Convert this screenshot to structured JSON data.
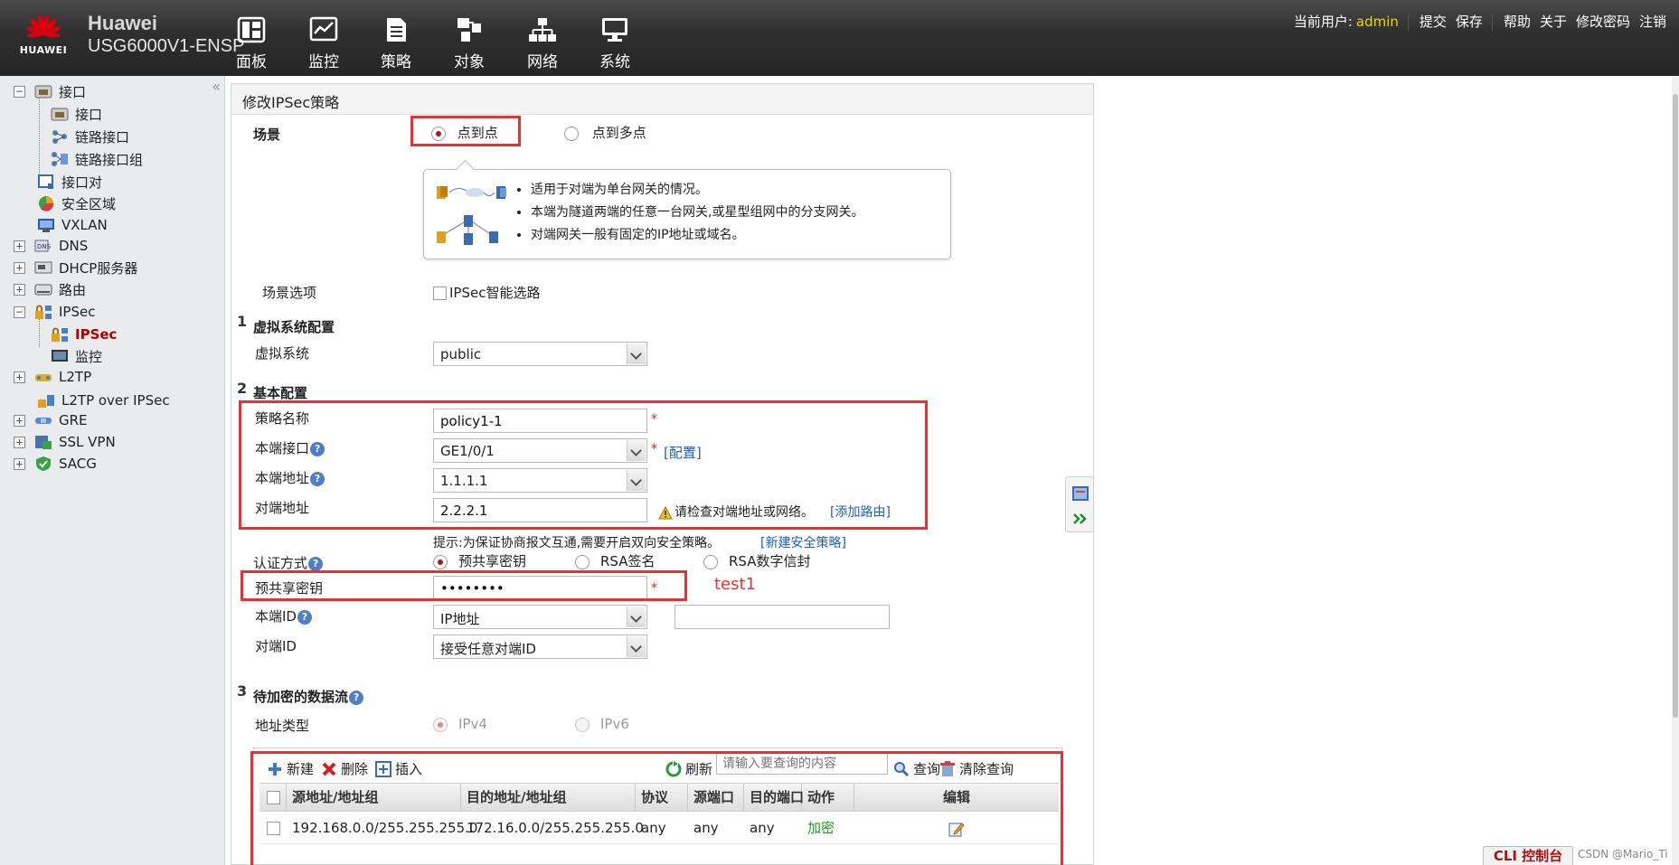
{
  "header": {
    "brand": "Huawei",
    "logo_text": "HUAWEI",
    "model": "USG6000V1-ENSP",
    "nav": [
      {
        "label": "面板",
        "icon": "dashboard-icon"
      },
      {
        "label": "监控",
        "icon": "monitor-icon"
      },
      {
        "label": "策略",
        "icon": "policy-icon"
      },
      {
        "label": "对象",
        "icon": "object-icon"
      },
      {
        "label": "网络",
        "icon": "network-icon"
      },
      {
        "label": "系统",
        "icon": "system-icon"
      }
    ],
    "user_label": "当前用户:",
    "username": "admin",
    "actions": [
      "提交",
      "保存",
      "帮助",
      "关于",
      "修改密码",
      "注销"
    ]
  },
  "sidebar": {
    "items": [
      {
        "label": "接口",
        "icon": "interface-icon",
        "toggle": "−"
      },
      {
        "label": "接口",
        "icon": "interface-icon"
      },
      {
        "label": "链路接口",
        "icon": "link-interface-icon"
      },
      {
        "label": "链路接口组",
        "icon": "link-group-icon"
      },
      {
        "label": "接口对",
        "icon": "interface-pair-icon"
      },
      {
        "label": "安全区域",
        "icon": "security-zone-icon"
      },
      {
        "label": "VXLAN",
        "icon": "vxlan-icon"
      },
      {
        "label": "DNS",
        "icon": "dns-icon",
        "toggle": "+"
      },
      {
        "label": "DHCP服务器",
        "icon": "dhcp-icon",
        "toggle": "+"
      },
      {
        "label": "路由",
        "icon": "route-icon",
        "toggle": "+"
      },
      {
        "label": "IPSec",
        "icon": "ipsec-icon",
        "toggle": "−"
      },
      {
        "label": "IPSec",
        "icon": "ipsec-icon",
        "active": true
      },
      {
        "label": "监控",
        "icon": "monitor-icon"
      },
      {
        "label": "L2TP",
        "icon": "l2tp-icon",
        "toggle": "+"
      },
      {
        "label": "L2TP over IPSec",
        "icon": "l2tp-ipsec-icon"
      },
      {
        "label": "GRE",
        "icon": "gre-icon",
        "toggle": "+"
      },
      {
        "label": "SSL VPN",
        "icon": "ssl-vpn-icon",
        "toggle": "+"
      },
      {
        "label": "SACG",
        "icon": "sacg-icon",
        "toggle": "+"
      }
    ]
  },
  "form": {
    "title": "修改IPSec策略",
    "scene_label": "场景",
    "scene_options": [
      "点到点",
      "点到多点"
    ],
    "scene_selected": "点到点",
    "tips": [
      "适用于对端为单台网关的情况。",
      "本端为隧道两端的任意一台网关,或星型组网中的分支网关。",
      "对端网关一般有固定的IP地址或域名。"
    ],
    "scene_option_label": "场景选项",
    "smart_route_label": "IPSec智能选路",
    "sec1_num": "1",
    "sec1_title": "虚拟系统配置",
    "vsys_label": "虚拟系统",
    "vsys_value": "public",
    "sec2_num": "2",
    "sec2_title": "基本配置",
    "policy_name_label": "策略名称",
    "policy_name_value": "policy1-1",
    "local_if_label": "本端接口",
    "local_if_value": "GE1/0/1",
    "config_link": "[配置]",
    "local_addr_label": "本端地址",
    "local_addr_value": "1.1.1.1",
    "peer_addr_label": "对端地址",
    "peer_addr_value": "2.2.2.1",
    "peer_warn": "请检查对端地址或网络。",
    "add_route_link": "[添加路由]",
    "hint_text": "提示:为保证协商报文互通,需要开启双向安全策略。",
    "new_policy_link": "[新建安全策略]",
    "auth_label": "认证方式",
    "auth_options": [
      "预共享密钥",
      "RSA签名",
      "RSA数字信封"
    ],
    "psk_label": "预共享密钥",
    "psk_value": "••••••••",
    "psk_annotation": "test1",
    "local_id_label": "本端ID",
    "local_id_value": "IP地址",
    "local_id_extra": "",
    "peer_id_label": "对端ID",
    "peer_id_value": "接受任意对端ID",
    "required_mark": "*",
    "help_mark": "?",
    "sec3_num": "3",
    "sec3_title": "待加密的数据流",
    "addr_type_label": "地址类型",
    "addr_type_options": [
      "IPv4",
      "IPv6"
    ]
  },
  "grid": {
    "toolbar": {
      "new": "新建",
      "delete": "删除",
      "insert": "插入",
      "refresh": "刷新",
      "search_placeholder": "请输入要查询的内容",
      "query": "查询",
      "clear": "清除查询"
    },
    "columns": [
      "源地址/地址组",
      "目的地址/地址组",
      "协议",
      "源端口",
      "目的端口",
      "动作",
      "编辑"
    ],
    "rows": [
      {
        "src": "192.168.0.0/255.255.255.0",
        "dst": "172.16.0.0/255.255.255.0",
        "proto": "any",
        "sport": "any",
        "dport": "any",
        "action": "加密"
      }
    ]
  },
  "footer": {
    "cli": "CLI 控制台",
    "watermark": "CSDN @Mario_Ti"
  },
  "colors": {
    "accent_red": "#b4141e",
    "highlight_box": "#e63232",
    "link_blue": "#1c5fc2",
    "username_yellow": "#f2d500",
    "action_green": "#1e9a1e"
  }
}
